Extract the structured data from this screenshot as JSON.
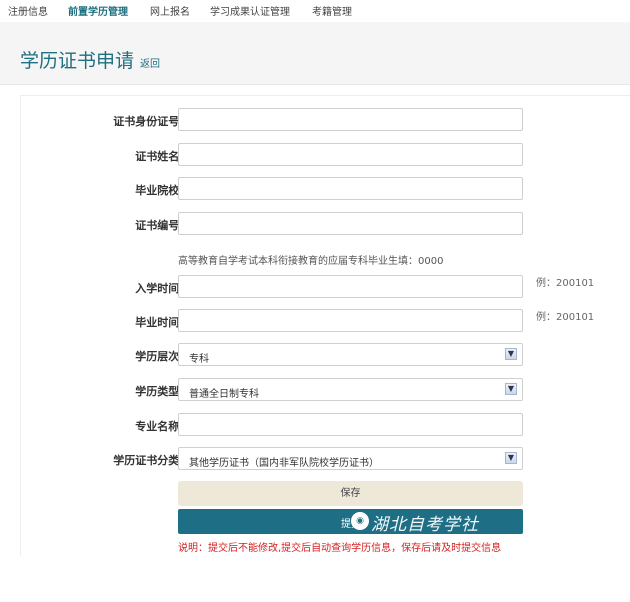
{
  "nav": {
    "items": [
      {
        "label": "注册信息",
        "active": false
      },
      {
        "label": "前置学历管理",
        "active": true
      },
      {
        "label": "网上报名",
        "active": false
      },
      {
        "label": "学习成果认证管理",
        "active": false
      },
      {
        "label": "考籍管理",
        "active": false
      }
    ]
  },
  "header": {
    "title": "学历证书申请",
    "back_label": "返回"
  },
  "form": {
    "required_mark": "*",
    "fields": {
      "id_number": {
        "label": "证书身份证号",
        "value": ""
      },
      "name": {
        "label": "证书姓名",
        "value": ""
      },
      "school": {
        "label": "毕业院校",
        "value": ""
      },
      "cert_number": {
        "label": "证书编号",
        "value": ""
      },
      "enroll_time": {
        "label": "入学时间",
        "value": "",
        "hint": "例：200101"
      },
      "grad_time": {
        "label": "毕业时间",
        "value": "",
        "hint": "例：200101"
      },
      "level": {
        "label": "学历层次",
        "value": "专科"
      },
      "type": {
        "label": "学历类型",
        "value": "普通全日制专科"
      },
      "major": {
        "label": "专业名称",
        "value": ""
      },
      "category": {
        "label": "学历证书分类",
        "value": "其他学历证书（国内非军队院校学历证书）"
      }
    },
    "note": "高等教育自学考试本科衔接教育的应届专科毕业生填：0000",
    "save_label": "保存",
    "submit_label": "提交",
    "watermark_text": "湖北自考学社",
    "explain": "说明：提交后不能修改,提交后自动查询学历信息，保存后请及时提交信息"
  },
  "colors": {
    "accent": "#1f6f80",
    "submit_bg": "#1e6f85",
    "save_bg": "#ede8d8",
    "required": "#dd0000",
    "warning_text": "#d52020"
  },
  "icons": {
    "dropdown": "chevron-down-icon",
    "seal": "seal-logo-icon"
  }
}
